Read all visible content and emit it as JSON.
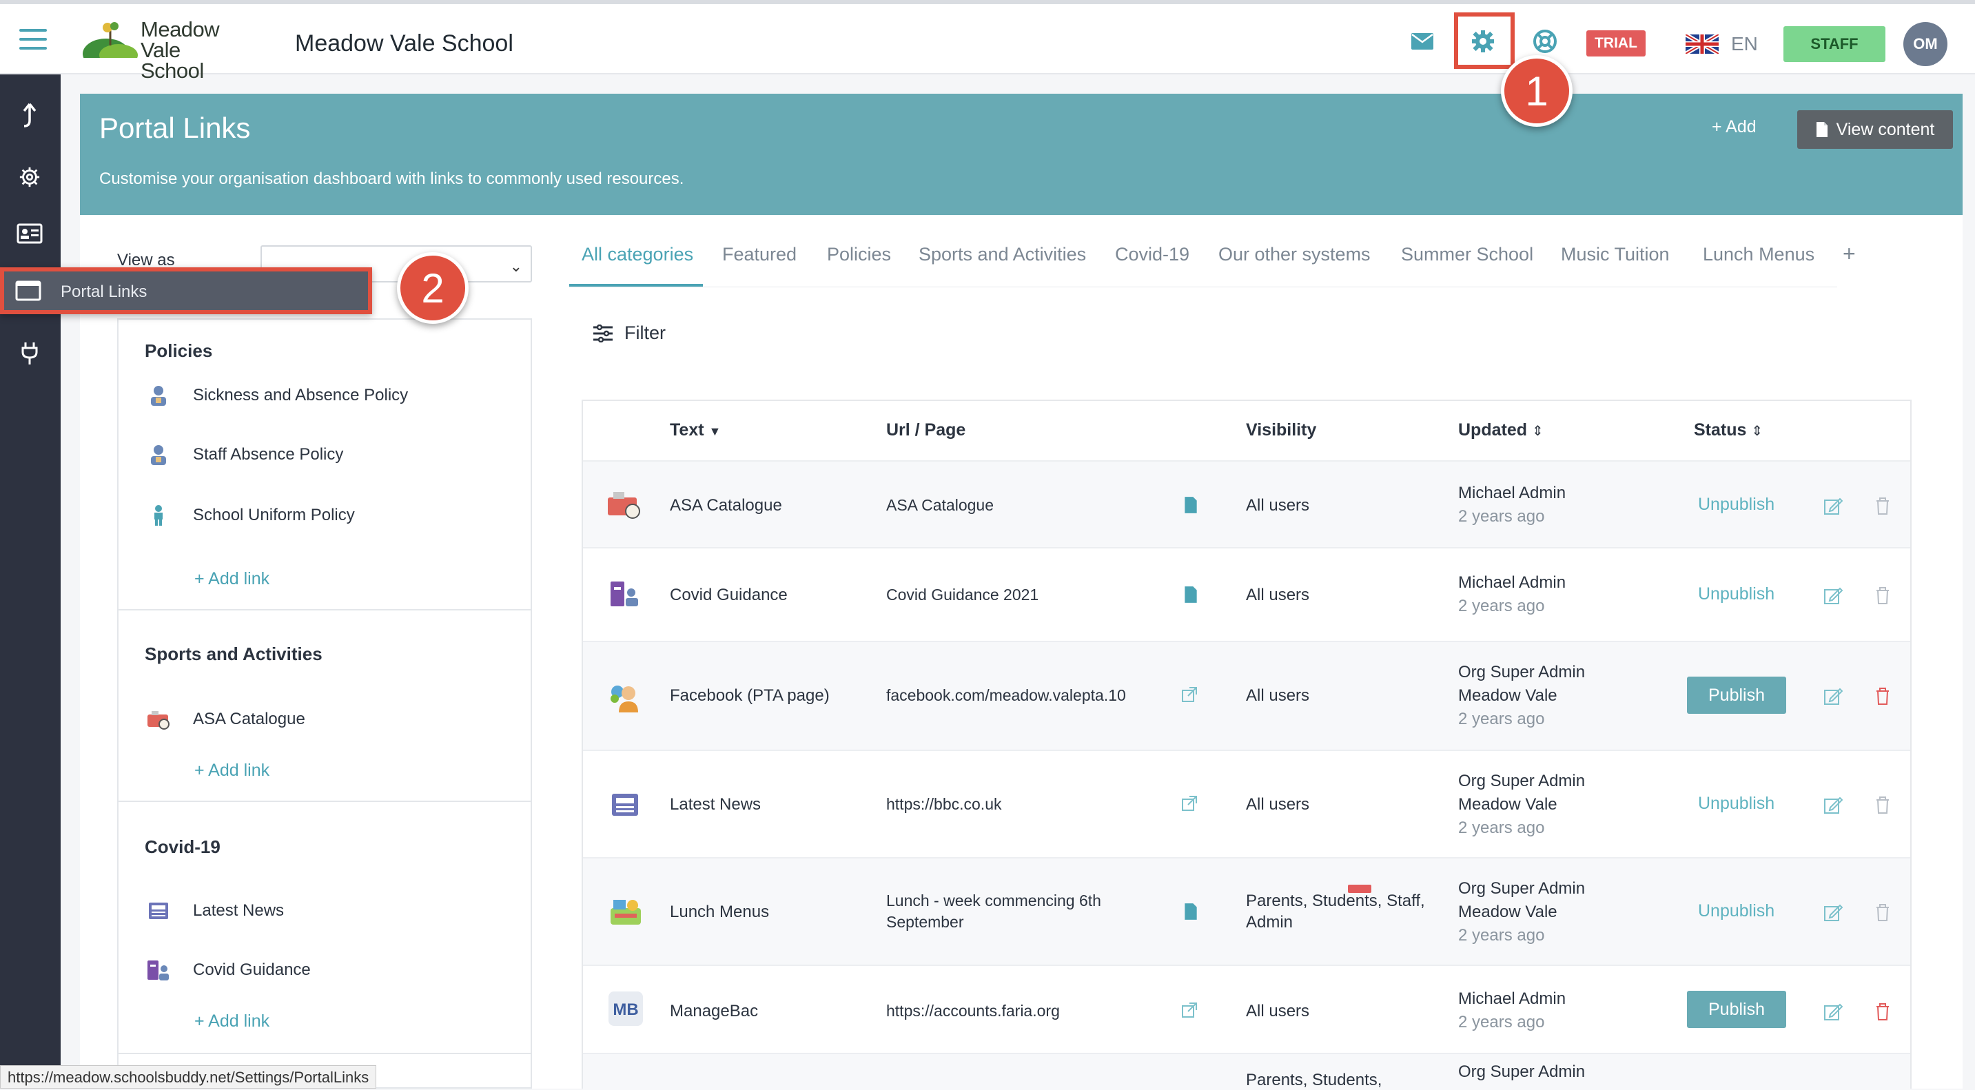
{
  "topbar": {
    "logo_text": "Meadow\nVale School",
    "school_name": "Meadow Vale School",
    "icons": [
      "menu-icon",
      "mail-icon",
      "gear-icon",
      "help-icon"
    ],
    "trial_badge": "TRIAL",
    "language": "EN",
    "role_button": "STAFF",
    "avatar_initials": "OM"
  },
  "annotations": {
    "callout_1": "1",
    "callout_2": "2"
  },
  "rail": {
    "icons": [
      "arrow-up-icon",
      "gear-icon",
      "id-card-icon",
      "window-icon",
      "plug-icon"
    ]
  },
  "flyout": {
    "label": "Portal Links"
  },
  "header": {
    "title": "Portal Links",
    "subtitle": "Customise your organisation dashboard with links to commonly used resources.",
    "add_label": "+ Add",
    "view_content_label": "View content"
  },
  "view_as": {
    "label": "View as"
  },
  "side_panel": {
    "categories": [
      {
        "title": "Policies",
        "items": [
          "Sickness and Absence Policy",
          "Staff Absence Policy",
          "School Uniform Policy"
        ],
        "add_link": "+ Add link"
      },
      {
        "title": "Sports and Activities",
        "items": [
          "ASA Catalogue"
        ],
        "add_link": "+ Add link"
      },
      {
        "title": "Covid-19",
        "items": [
          "Latest News",
          "Covid Guidance"
        ],
        "add_link": "+ Add link"
      }
    ]
  },
  "tabs": [
    "All categories",
    "Featured",
    "Policies",
    "Sports and Activities",
    "Covid-19",
    "Our other systems",
    "Summer School",
    "Music Tuition",
    "Lunch Menus",
    "+"
  ],
  "filter_label": "Filter",
  "table": {
    "headers": {
      "text": "Text",
      "url": "Url / Page",
      "visibility": "Visibility",
      "updated": "Updated",
      "status": "Status"
    },
    "rows": [
      {
        "text": "ASA Catalogue",
        "url": "ASA Catalogue",
        "url_type": "page",
        "visibility": "All users",
        "updated_by": "Michael Admin",
        "updated_org": "",
        "updated_ago": "2 years ago",
        "status": "Unpublish"
      },
      {
        "text": "Covid Guidance",
        "url": "Covid Guidance 2021",
        "url_type": "page",
        "visibility": "All users",
        "updated_by": "Michael Admin",
        "updated_org": "",
        "updated_ago": "2 years ago",
        "status": "Unpublish"
      },
      {
        "text": "Facebook (PTA page)",
        "url": "facebook.com/meadow.valepta.10",
        "url_type": "external",
        "visibility": "All users",
        "updated_by": "Org Super Admin",
        "updated_org": "Meadow Vale",
        "updated_ago": "2 years ago",
        "status": "Publish"
      },
      {
        "text": "Latest News",
        "url": "https://bbc.co.uk",
        "url_type": "external",
        "visibility": "All users",
        "updated_by": "Org Super Admin",
        "updated_org": "Meadow Vale",
        "updated_ago": "2 years ago",
        "status": "Unpublish"
      },
      {
        "text": "Lunch Menus",
        "url": "Lunch - week commencing 6th\nSeptember",
        "url_type": "page",
        "visibility": "Parents, Students, Staff,\nAdmin",
        "updated_by": "Org Super Admin",
        "updated_org": "Meadow Vale",
        "updated_ago": "2 years ago",
        "status": "Unpublish"
      },
      {
        "text": "ManageBac",
        "url": "https://accounts.faria.org",
        "url_type": "external",
        "visibility": "All users",
        "updated_by": "Michael Admin",
        "updated_org": "",
        "updated_ago": "2 years ago",
        "status": "Publish"
      },
      {
        "text": "",
        "url": "",
        "url_type": "",
        "visibility": "Parents, Students,",
        "updated_by": "Org Super Admin",
        "updated_org": "",
        "updated_ago": "",
        "status": ""
      }
    ]
  },
  "status_bar": "https://meadow.schoolsbuddy.net/Settings/PortalLinks",
  "colors": {
    "accent": "#4aa3b4",
    "banner": "#68aab4",
    "rail": "#2d3240",
    "trial": "#e25b5b",
    "staff": "#7cd68f",
    "annotation": "#e0503f"
  }
}
